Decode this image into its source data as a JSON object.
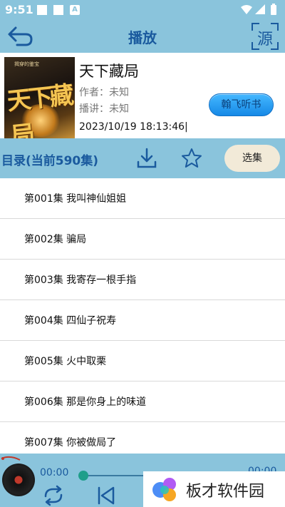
{
  "status_bar": {
    "time": "9:51",
    "a_label": "A"
  },
  "header": {
    "title": "播放",
    "source_label": "源"
  },
  "book": {
    "title": "天下藏局",
    "author": "作者：未知",
    "narrator": "播讲：未知",
    "timestamp": "2023/10/19 18:13:46|",
    "cover_text": "天下藏局",
    "cover_small_text": "揭穿的鉴宝"
  },
  "brand_button_label": "翰飞听书",
  "directory": {
    "label": "目录(当前590集)",
    "select_label": "选集"
  },
  "episodes": [
    "第001集 我叫神仙姐姐",
    "第002集 骗局",
    "第003集 我寄存一根手指",
    "第004集 四仙子祝寿",
    "第005集 火中取栗",
    "第006集 那是你身上的味道",
    "第007集 你被做局了"
  ],
  "player": {
    "current_time": "00:00",
    "end_time": "00:00",
    "progress": 0
  },
  "watermark": {
    "text": "板才软件园"
  },
  "colors": {
    "bar": "#8ac4dc",
    "accent": "#1a5a9e",
    "brand_button": "#2196f3",
    "select_button": "#f2ead8"
  }
}
